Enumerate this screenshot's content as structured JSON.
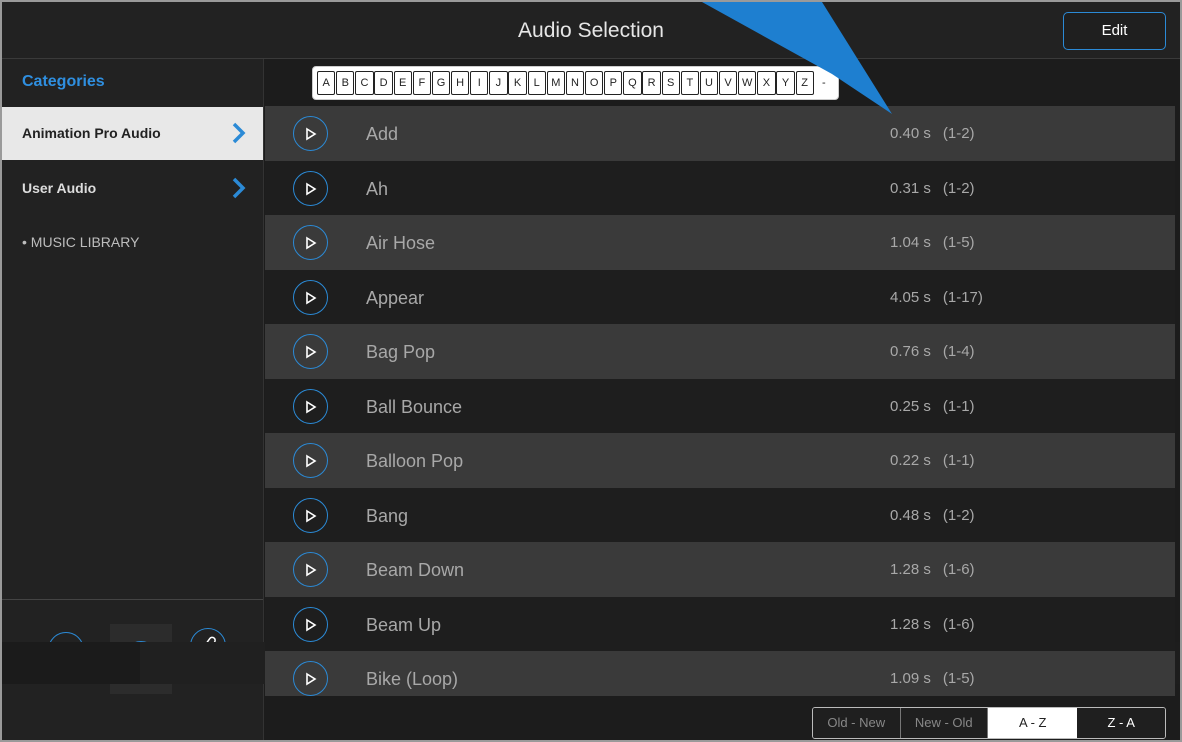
{
  "header": {
    "title": "Audio Selection",
    "edit_label": "Edit"
  },
  "sidebar": {
    "heading": "Categories",
    "items": [
      {
        "label": "Animation Pro Audio",
        "selected": true
      },
      {
        "label": "User Audio",
        "selected": false
      },
      {
        "label": "• MUSIC LIBRARY",
        "selected": false
      }
    ]
  },
  "alphabet": [
    "A",
    "B",
    "C",
    "D",
    "E",
    "F",
    "G",
    "H",
    "I",
    "J",
    "K",
    "L",
    "M",
    "N",
    "O",
    "P",
    "Q",
    "R",
    "S",
    "T",
    "U",
    "V",
    "W",
    "X",
    "Y",
    "Z",
    "-"
  ],
  "sounds": [
    {
      "name": "Add",
      "duration": "0.40 s",
      "range": "(1-2)"
    },
    {
      "name": "Ah",
      "duration": "0.31 s",
      "range": "(1-2)"
    },
    {
      "name": "Air Hose",
      "duration": "1.04 s",
      "range": "(1-5)"
    },
    {
      "name": "Appear",
      "duration": "4.05 s",
      "range": "(1-17)"
    },
    {
      "name": "Bag Pop",
      "duration": "0.76 s",
      "range": "(1-4)"
    },
    {
      "name": "Ball Bounce",
      "duration": "0.25 s",
      "range": "(1-1)"
    },
    {
      "name": "Balloon Pop",
      "duration": "0.22 s",
      "range": "(1-1)"
    },
    {
      "name": "Bang",
      "duration": "0.48 s",
      "range": "(1-2)"
    },
    {
      "name": "Beam Down",
      "duration": "1.28 s",
      "range": "(1-6)"
    },
    {
      "name": "Beam Up",
      "duration": "1.28 s",
      "range": "(1-6)"
    },
    {
      "name": "Bike (Loop)",
      "duration": "1.09 s",
      "range": "(1-5)"
    }
  ],
  "sort": {
    "options": [
      "Old - New",
      "New - Old",
      "A - Z",
      "Z - A"
    ],
    "selected": "A - Z"
  },
  "colors": {
    "accent": "#2b8ad6",
    "callout": "#1e7fd0"
  }
}
